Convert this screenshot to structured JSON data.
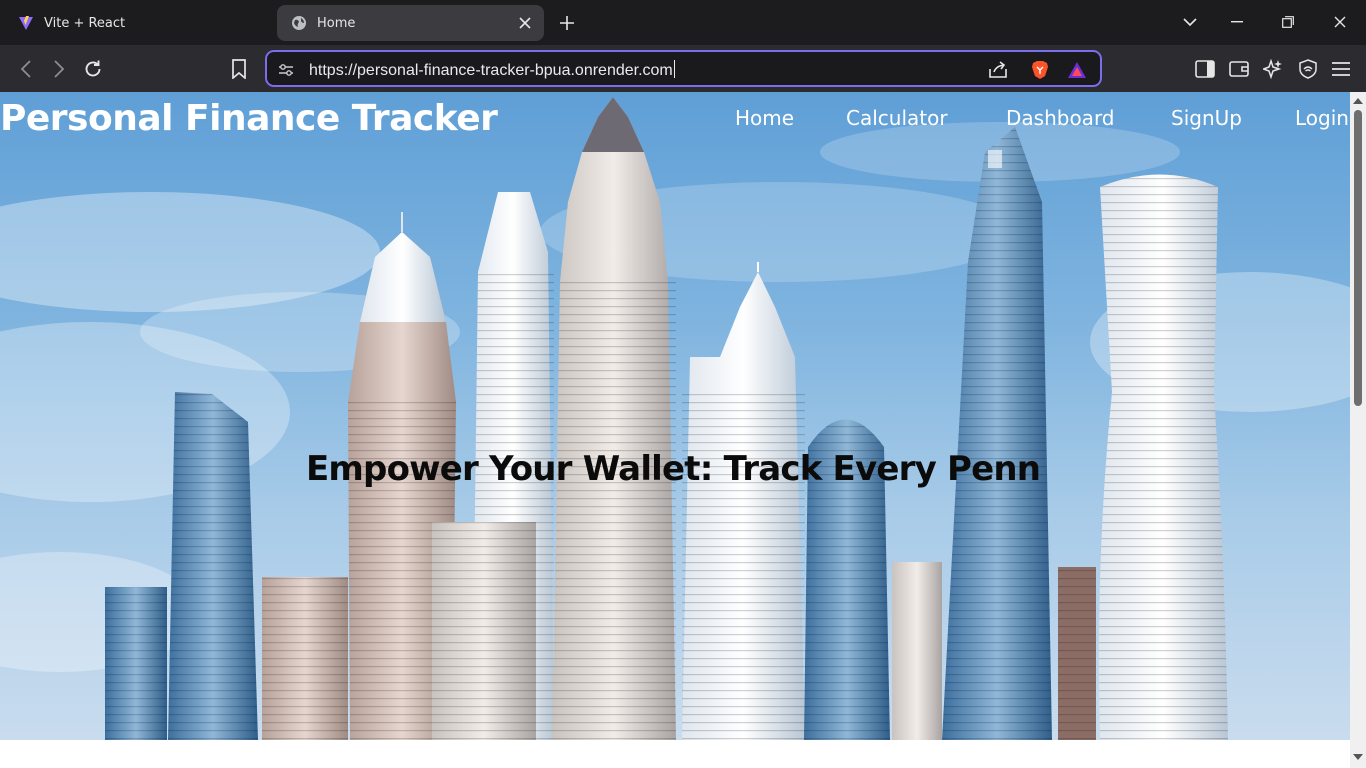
{
  "browser": {
    "tabs": [
      {
        "title": "Vite + React",
        "favicon": "vite-icon",
        "active": false
      },
      {
        "title": "Home",
        "favicon": "globe-icon",
        "active": true
      }
    ],
    "address_bar": {
      "url": "https://personal-finance-tracker-bpua.onrender.com"
    },
    "accent_color": "#7c6cf0"
  },
  "page": {
    "site_title": "Personal Finance Tracker",
    "nav": [
      "Home",
      "Calculator",
      "Dashboard",
      "SignUp",
      "Login"
    ],
    "headline": "Empower Your Wallet: Track Every Penn"
  }
}
